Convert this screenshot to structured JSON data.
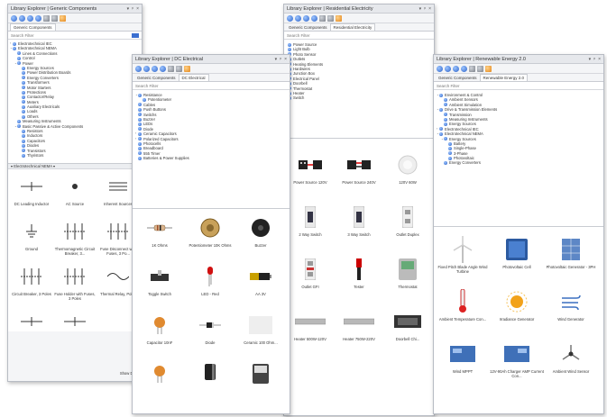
{
  "panels": {
    "generic": {
      "title": "Library Explorer | Generic Components",
      "controls": [
        "▾",
        "ᵖ",
        "×"
      ],
      "tabs": [
        "Generic Components"
      ],
      "search_placeholder": "Search Filter",
      "tree": [
        {
          "label": "Electrotechnical IEC",
          "exp": "›",
          "depth": 0
        },
        {
          "label": "Electrotechnical NEMA",
          "exp": "⌄",
          "depth": 0
        },
        {
          "label": "Lines & Connections",
          "exp": "",
          "depth": 1
        },
        {
          "label": "Control",
          "exp": "",
          "depth": 1
        },
        {
          "label": "Power",
          "exp": "⌄",
          "depth": 1
        },
        {
          "label": "Energy Sources",
          "exp": "",
          "depth": 2
        },
        {
          "label": "Power Distribution Boards",
          "exp": "",
          "depth": 2
        },
        {
          "label": "Energy Converters",
          "exp": "",
          "depth": 2
        },
        {
          "label": "Transformers",
          "exp": "",
          "depth": 2
        },
        {
          "label": "Motor Starters",
          "exp": "",
          "depth": 2
        },
        {
          "label": "Protections",
          "exp": "",
          "depth": 2
        },
        {
          "label": "Contactor/Relay",
          "exp": "",
          "depth": 2
        },
        {
          "label": "Meters",
          "exp": "",
          "depth": 2
        },
        {
          "label": "Auxiliary Electricals",
          "exp": "",
          "depth": 2
        },
        {
          "label": "Loads",
          "exp": "",
          "depth": 2
        },
        {
          "label": "Others",
          "exp": "",
          "depth": 2
        },
        {
          "label": "Measuring Instruments",
          "exp": "",
          "depth": 1
        },
        {
          "label": "Basic Passive & Active Components",
          "exp": "⌄",
          "depth": 1
        },
        {
          "label": "Resistors",
          "exp": "",
          "depth": 2
        },
        {
          "label": "Inductors",
          "exp": "",
          "depth": 2
        },
        {
          "label": "Capacitors",
          "exp": "",
          "depth": 2
        },
        {
          "label": "Diodes",
          "exp": "",
          "depth": 2
        },
        {
          "label": "Transistors",
          "exp": "",
          "depth": 2
        },
        {
          "label": "Thyristors",
          "exp": "",
          "depth": 2
        }
      ],
      "section_label": "▾ Electrotechnical NEMA ▾",
      "items": [
        "DC Leading Inductor",
        "AC Source",
        "Inherent Sources",
        "Ground",
        "Thermomagnetic Circuit Breaker, 3...",
        "Fuse Disconnect with Fuses, 3 Po...",
        "Circuit Breaker, 3 Poles",
        "Fuse Holder with Fuses, 3 Poles",
        "Thermal Relay, Poles",
        "",
        "",
        ""
      ],
      "show_label": "Show Desc"
    },
    "dc": {
      "title": "Library Explorer | DC Electrical",
      "controls": [
        "▾",
        "ᵖ",
        "×"
      ],
      "tabs": [
        "Generic Components",
        "DC Electrical"
      ],
      "search_placeholder": "Search Filter",
      "tree": [
        {
          "label": "Resistance",
          "exp": "⌄",
          "depth": 0
        },
        {
          "label": "Potentiometer",
          "exp": "",
          "depth": 1
        },
        {
          "label": "Cables",
          "exp": "",
          "depth": 0
        },
        {
          "label": "Push Buttons",
          "exp": "",
          "depth": 0
        },
        {
          "label": "Switchs",
          "exp": "",
          "depth": 0
        },
        {
          "label": "Buzzer",
          "exp": "",
          "depth": 0
        },
        {
          "label": "LEDs",
          "exp": "",
          "depth": 0
        },
        {
          "label": "Diode",
          "exp": "",
          "depth": 0
        },
        {
          "label": "Ceramic Capacitors",
          "exp": "›",
          "depth": 0
        },
        {
          "label": "Polarized Capacitors",
          "exp": "›",
          "depth": 0
        },
        {
          "label": "Photocells",
          "exp": "",
          "depth": 0
        },
        {
          "label": "Breadboard",
          "exp": "",
          "depth": 0
        },
        {
          "label": "555 Timer",
          "exp": "",
          "depth": 0
        },
        {
          "label": "Batteries & Power Supplies",
          "exp": "",
          "depth": 0
        }
      ],
      "items": [
        "1K Ohms",
        "Potentiometer 10K Ohms",
        "Buzzer",
        "Toggle Switch",
        "LED - Red",
        "AA 3V",
        "Capacitor 10nF",
        "Diode",
        "Ceramic 100 Ohm...",
        "",
        "",
        ""
      ]
    },
    "res": {
      "title": "Library Explorer | Residential Electricity",
      "controls": [
        "▾",
        "ᵖ",
        "×"
      ],
      "tabs": [
        "Generic Components",
        "Residential Electricity"
      ],
      "search_placeholder": "Search Filter",
      "tree": [
        {
          "label": "Power Source"
        },
        {
          "label": "Light Bulb"
        },
        {
          "label": "Photo Sensor"
        },
        {
          "label": "Outlets"
        },
        {
          "label": "Heating Elements"
        },
        {
          "label": "Hardwires"
        },
        {
          "label": "Junction Box"
        },
        {
          "label": "Electrical Panel"
        },
        {
          "label": "Doorbell"
        },
        {
          "label": "Thermostat"
        },
        {
          "label": "Heater"
        },
        {
          "label": "Switch"
        }
      ],
      "items": [
        "Power Source 120V",
        "Power Source 240V",
        "120V 60W",
        "2 Way Switch",
        "3 Way Switch",
        "Outlet Duplex",
        "Outlet GFI",
        "Tester",
        "Thermostat",
        "Heater 500W-120V",
        "Heater 750W-220V",
        "Doorbell Chi..."
      ]
    },
    "renew": {
      "title": "Library Explorer | Renewable Energy 2.0",
      "controls": [
        "▾",
        "ᵖ",
        "×"
      ],
      "tabs": [
        "Generic Components",
        "Renewable Energy 2.0"
      ],
      "search_placeholder": "Search Filter",
      "tree": [
        {
          "label": "Environment & Control",
          "exp": "⌄",
          "depth": 0
        },
        {
          "label": "Ambient Sensors",
          "exp": "",
          "depth": 1
        },
        {
          "label": "Ambient Simulation",
          "exp": "",
          "depth": 1
        },
        {
          "label": "Drive & Transmission Elements",
          "exp": "⌄",
          "depth": 0
        },
        {
          "label": "Transmission",
          "exp": "",
          "depth": 1
        },
        {
          "label": "Measuring Instruments",
          "exp": "",
          "depth": 1
        },
        {
          "label": "Energy Sources",
          "exp": "",
          "depth": 1
        },
        {
          "label": "Electrotechnical IEC",
          "exp": "›",
          "depth": 0
        },
        {
          "label": "Electrotechnical NEMA",
          "exp": "⌄",
          "depth": 0
        },
        {
          "label": "Energy Sources",
          "exp": "⌄",
          "depth": 1
        },
        {
          "label": "Battery",
          "exp": "",
          "depth": 2
        },
        {
          "label": "Single-Phase",
          "exp": "",
          "depth": 2
        },
        {
          "label": "3-Phase",
          "exp": "",
          "depth": 2
        },
        {
          "label": "Photovoltaic",
          "exp": "",
          "depth": 2
        },
        {
          "label": "Energy Converters",
          "exp": "",
          "depth": 1
        }
      ],
      "items": [
        "Fixed Pitch Blade Angle Wind Turbine",
        "Photovoltaic Cell",
        "Photovoltaic Generator - 3PH",
        "Ambient Temperature Con...",
        "Irradiance Generator",
        "Wind Generator",
        "Wind MPPT",
        "12V-90Ah Charger AMP Current Con...",
        "Ambient Wind Sensor",
        "",
        "",
        ""
      ]
    }
  },
  "colors": {
    "accent": "#2d63c8",
    "panel": "#f4f5f7",
    "border": "#b8bcc4"
  }
}
